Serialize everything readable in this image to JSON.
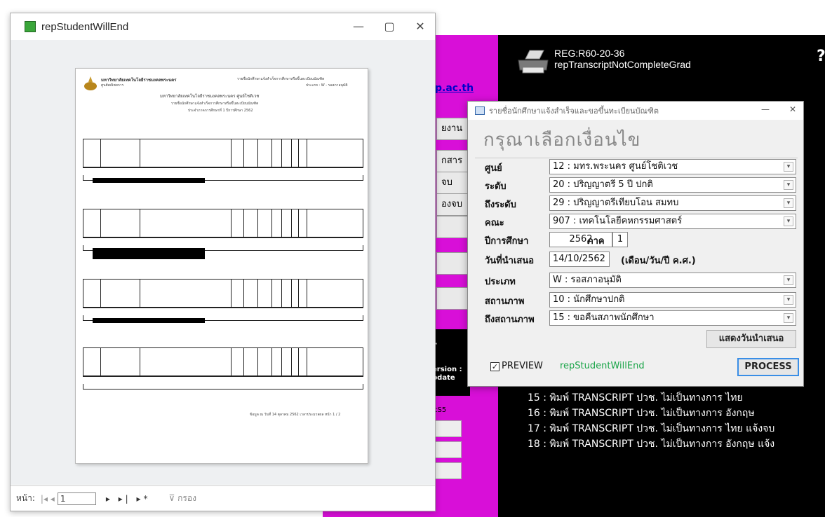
{
  "background": {
    "link_text": "p.ac.th",
    "magenta_buttons": [
      "ยงาน",
      "กสาร",
      "จบ",
      "องจบ"
    ],
    "black_box_lines": [
      "r",
      "ersion :",
      "pdate"
    ],
    "small_label": "cS5",
    "report_code": "REG:R60-20-36",
    "report_name": "repTranscriptNotCompleteGrad",
    "qmark": "?",
    "menu_items": [
      "15 : พิมพ์ TRANSCRIPT ปวช. ไม่เป็นทางการ ไทย",
      "16 : พิมพ์ TRANSCRIPT ปวช. ไม่เป็นทางการ อังกฤษ",
      "17 : พิมพ์ TRANSCRIPT ปวช. ไม่เป็นทางการ ไทย แจ้งจบ",
      "18 : พิมพ์ TRANSCRIPT ปวช. ไม่เป็นทางการ อังกฤษ แจ้ง"
    ],
    "colors": {
      "magenta": "#d80fd8",
      "black": "#000000"
    }
  },
  "preview_window": {
    "title": "repStudentWillEnd",
    "controls": [
      "minimize-icon",
      "maximize-icon",
      "close-icon"
    ],
    "paper": {
      "university": "มหาวิทยาลัยเทคโนโลยีราชมงคลพระนคร",
      "center": "ศูนย์พณิชยการ",
      "right_title": "รายชื่อนักศึกษาแจ้งสำเร็จการศึกษาหรือขึ้นทะเบียนบัณฑิต",
      "type_line": "ประเภท : W - รอสภาอนุมัติ",
      "heading_1": "มหาวิทยาลัยเทคโนโลยีราชมงคลพระนคร ศูนย์โชติเวช",
      "heading_2": "รายชื่อนักศึกษาแจ้งสำเร็จการศึกษาหรือขึ้นทะเบียนบัณฑิต",
      "heading_3": "ประจำภาคการศึกษาที่ 1 ปีการศึกษา 2562",
      "footer": "ข้อมูล ณ วันที่ 14 ตุลาคม 2562 เวลาประมวลผล หน้า 1 / 2"
    },
    "status_bar": {
      "page_label": "หน้า:",
      "nav_first": "|◂ ◂",
      "page_value": "1",
      "nav_last": "▸ ▸| ▸*",
      "filter_label": "⊽ กรอง"
    }
  },
  "dialog": {
    "title": "รายชื่อนักศึกษาแจ้งสำเร็จและขอขึ้นทะเบียนบัณฑิต",
    "heading": "กรุณาเลือกเงื่อนไข",
    "fields": {
      "center_label": "ศูนย์",
      "center_value": "12 : มทร.พระนคร ศูนย์โชติเวช",
      "level_label": "ระดับ",
      "level_value": "20 : ปริญญาตรี 5 ปี ปกติ",
      "to_level_label": "ถึงระดับ",
      "to_level_value": "29 : ปริญญาตรีเทียบโอน สมทบ",
      "faculty_label": "คณะ",
      "faculty_value": "907 : เทคโนโลยีคหกรรมศาสตร์",
      "year_label": "ปีการศึกษา",
      "year_value": "2562",
      "term_label": "ภาค",
      "term_value": "1",
      "date_label": "วันที่นำเสนอ",
      "date_value": "14/10/2562",
      "date_hint": "(เดือน/วัน/ปี ค.ศ.)",
      "type_label": "ประเภท",
      "type_value": "W : รอสภาอนุมัติ",
      "status_label": "สถานภาพ",
      "status_value": "10 : นักศึกษาปกติ",
      "to_status_label": "ถึงสถานภาพ",
      "to_status_value": "15 : ขอคืนสภาพนักศึกษา"
    },
    "show_date_button": "แสดงวันนำเสนอ",
    "preview_label": "PREVIEW",
    "preview_report": "repStudentWillEnd",
    "preview_checked": true,
    "process_button": "PROCESS"
  }
}
